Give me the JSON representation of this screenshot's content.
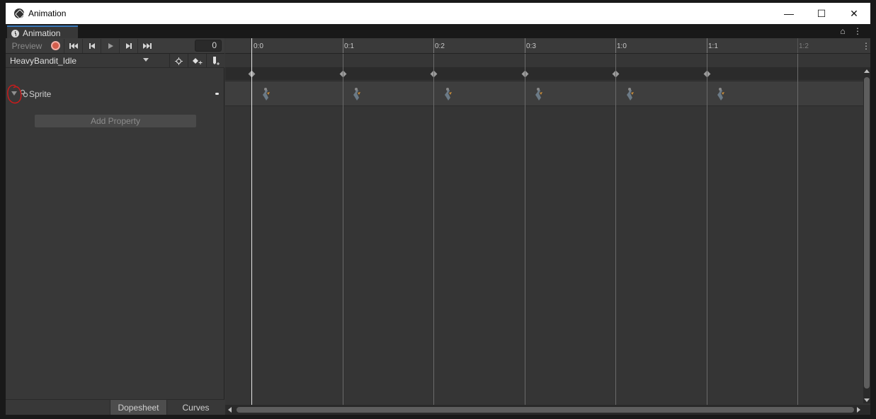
{
  "window": {
    "title": "Animation",
    "controls": {
      "minimize": "—",
      "maximize": "☐",
      "close": "✕"
    }
  },
  "tab": {
    "label": "Animation",
    "tools": "⌂ ⋮"
  },
  "controls": {
    "preview_label": "Preview",
    "frame_value": "0",
    "buttons": [
      "first-key",
      "prev-key",
      "play",
      "next-key",
      "last-key"
    ]
  },
  "clip": {
    "name": "HeavyBandit_Idle"
  },
  "property": {
    "name": "Sprite"
  },
  "add_property_label": "Add Property",
  "bottom_tabs": {
    "dopesheet": "Dopesheet",
    "curves": "Curves"
  },
  "ruler": {
    "labels": [
      "0:0",
      "0:1",
      "0:2",
      "0:3",
      "1:0",
      "1:1",
      "1:2"
    ]
  },
  "keyframes_count": 6,
  "colors": {
    "accent": "#3a79bb",
    "record": "#d35d4c",
    "annotation": "#d11a1a"
  }
}
